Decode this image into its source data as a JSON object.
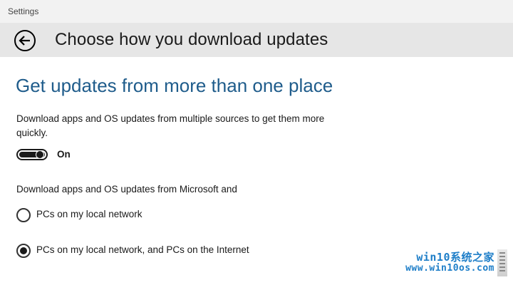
{
  "window": {
    "title": "Settings"
  },
  "header": {
    "back_icon": "arrow-left-circle-icon",
    "title": "Choose how you download updates"
  },
  "section": {
    "title": "Get updates from more than one place",
    "description": "Download apps and OS updates from multiple sources to get them more quickly.",
    "toggle": {
      "state_label": "On",
      "checked": true
    },
    "sources_label": "Download apps and OS updates from Microsoft and",
    "options": [
      {
        "label": "PCs on my local network",
        "selected": false
      },
      {
        "label": "PCs on my local network, and PCs on the Internet",
        "selected": true
      }
    ]
  },
  "watermark": {
    "line1": "win10系统之家",
    "line2": "www.win10os.com"
  },
  "colors": {
    "accent": "#1f5c8b",
    "header_bg": "#e6e6e6",
    "titlebar_bg": "#f2f2f2",
    "watermark": "#1e7ec8"
  }
}
